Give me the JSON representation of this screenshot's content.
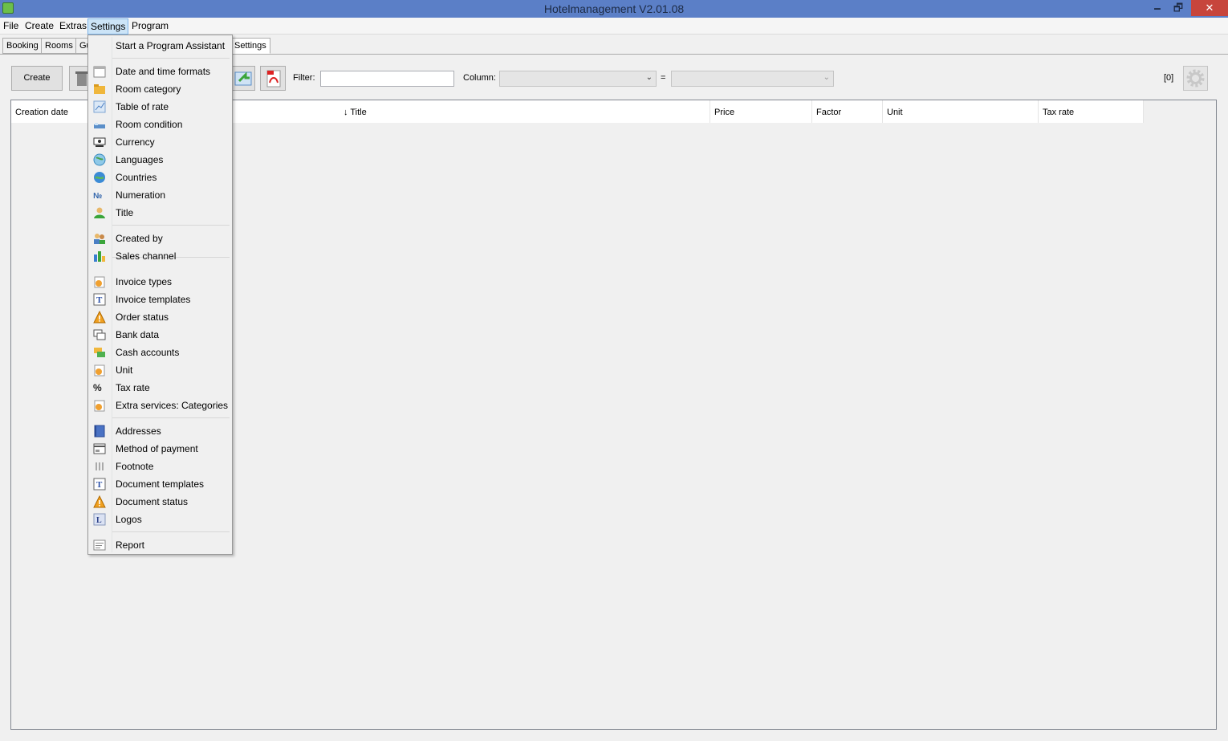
{
  "window": {
    "title": "Hotelmanagement V2.01.08",
    "minimize": "🗕",
    "restore": "🗗",
    "close": "✕"
  },
  "menubar": [
    "File",
    "Create",
    "Extras",
    "Settings",
    "Program"
  ],
  "tabs": [
    "Booking",
    "Rooms",
    "Gu",
    "Settings"
  ],
  "toolbar": {
    "create_label": "Create",
    "filter_label": "Filter:",
    "filter_value": "",
    "column_label": "Column:",
    "column_value": "",
    "equals": "=",
    "value_value": "",
    "count": "[0]"
  },
  "grid": {
    "columns": [
      "Creation date",
      "↓ Title",
      "Price",
      "Factor",
      "Unit",
      "Tax rate"
    ]
  },
  "settings_menu": {
    "items": [
      {
        "label": "Start a Program Assistant",
        "icon": "none"
      },
      {
        "label": "Date and time formats",
        "icon": "calendar-icon"
      },
      {
        "label": "Room category",
        "icon": "folder-icon"
      },
      {
        "label": "Table of rate",
        "icon": "chart-icon"
      },
      {
        "label": "Room condition",
        "icon": "bed-icon"
      },
      {
        "label": "Currency",
        "icon": "money-icon"
      },
      {
        "label": "Languages",
        "icon": "globe-icon"
      },
      {
        "label": "Countries",
        "icon": "earth-icon"
      },
      {
        "label": "Numeration",
        "icon": "numero-icon"
      },
      {
        "label": "Title",
        "icon": "person-icon"
      },
      {
        "label": "Created by",
        "icon": "users-icon"
      },
      {
        "label": "Sales channel",
        "icon": "bars-icon"
      },
      {
        "label": "Invoice types",
        "icon": "document-icon"
      },
      {
        "label": "Invoice templates",
        "icon": "template-icon"
      },
      {
        "label": "Order status",
        "icon": "warning-icon"
      },
      {
        "label": "Bank data",
        "icon": "bank-icon"
      },
      {
        "label": "Cash accounts",
        "icon": "cash-icon"
      },
      {
        "label": "Unit",
        "icon": "document-icon"
      },
      {
        "label": "Tax rate",
        "icon": "percent-icon"
      },
      {
        "label": "Extra services: Categories",
        "icon": "document-icon"
      },
      {
        "label": "Addresses",
        "icon": "book-icon"
      },
      {
        "label": "Method of payment",
        "icon": "card-icon"
      },
      {
        "label": "Footnote",
        "icon": "footnote-icon"
      },
      {
        "label": "Document templates",
        "icon": "template-icon"
      },
      {
        "label": "Document status",
        "icon": "warning-icon"
      },
      {
        "label": "Logos",
        "icon": "logo-icon"
      },
      {
        "label": "Report",
        "icon": "report-icon"
      }
    ]
  }
}
